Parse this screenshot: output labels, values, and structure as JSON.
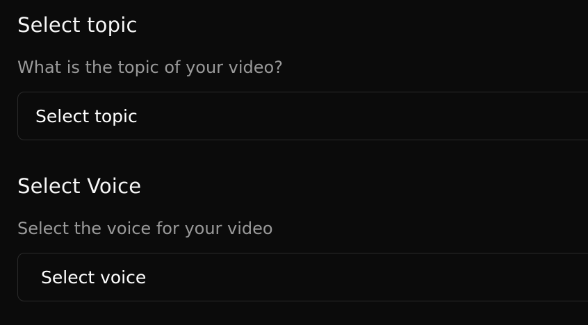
{
  "topic": {
    "title": "Select topic",
    "description": "What is the topic of your video?",
    "selected_value": "Select topic"
  },
  "voice": {
    "title": "Select Voice",
    "description": "Select the voice for your video",
    "selected_value": "Select voice"
  }
}
